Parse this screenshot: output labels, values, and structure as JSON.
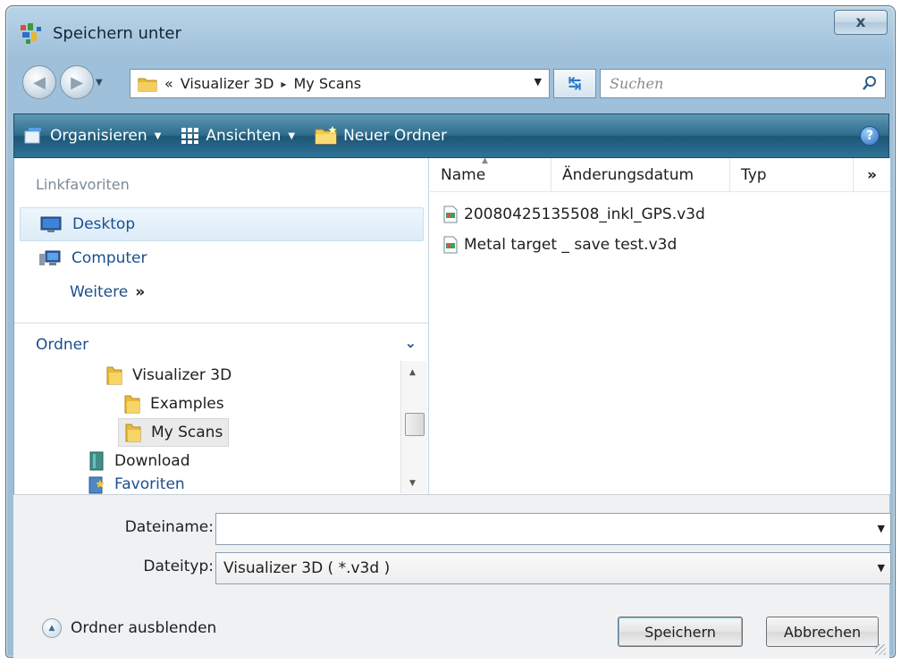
{
  "window": {
    "title": "Speichern unter",
    "close_label": "x"
  },
  "nav": {
    "breadcrumb_prefix": "«",
    "breadcrumb": [
      "Visualizer 3D",
      "My Scans"
    ],
    "breadcrumb_separator": "▸",
    "search_placeholder": "Suchen"
  },
  "toolbar": {
    "organize_label": "Organisieren",
    "views_label": "Ansichten",
    "new_folder_label": "Neuer Ordner",
    "help_label": "?"
  },
  "sidebar": {
    "favorites_header": "Linkfavoriten",
    "favorites": [
      {
        "label": "Desktop",
        "icon": "desktop-icon",
        "selected": true
      },
      {
        "label": "Computer",
        "icon": "computer-icon",
        "selected": false
      }
    ],
    "more_label": "Weitere",
    "more_chevron": "»",
    "folders_header": "Ordner",
    "tree": [
      {
        "label": "Visualizer 3D",
        "icon": "folder-icon"
      },
      {
        "label": "Examples",
        "icon": "folder-icon"
      },
      {
        "label": "My Scans",
        "icon": "folder-icon",
        "selected": true
      },
      {
        "label": "Download",
        "icon": "download-folder-icon"
      },
      {
        "label": "Favoriten",
        "icon": "favorites-folder-icon"
      }
    ]
  },
  "file_list": {
    "columns": [
      "Name",
      "Änderungsdatum",
      "Typ"
    ],
    "more_columns": "»",
    "files": [
      {
        "name": "20080425135508_inkl_GPS.v3d",
        "icon": "v3d-file-icon"
      },
      {
        "name": "Metal target _ save test.v3d",
        "icon": "v3d-file-icon"
      }
    ]
  },
  "form": {
    "filename_label": "Dateiname:",
    "filename_value": "",
    "filetype_label": "Dateityp:",
    "filetype_value": "Visualizer 3D ( *.v3d )",
    "hide_folders_label": "Ordner ausblenden",
    "save_label": "Speichern",
    "cancel_label": "Abbrechen"
  },
  "colors": {
    "accent": "#1b4f8e",
    "toolbar": "#2f6d8d",
    "frame": "#9fc0da"
  }
}
